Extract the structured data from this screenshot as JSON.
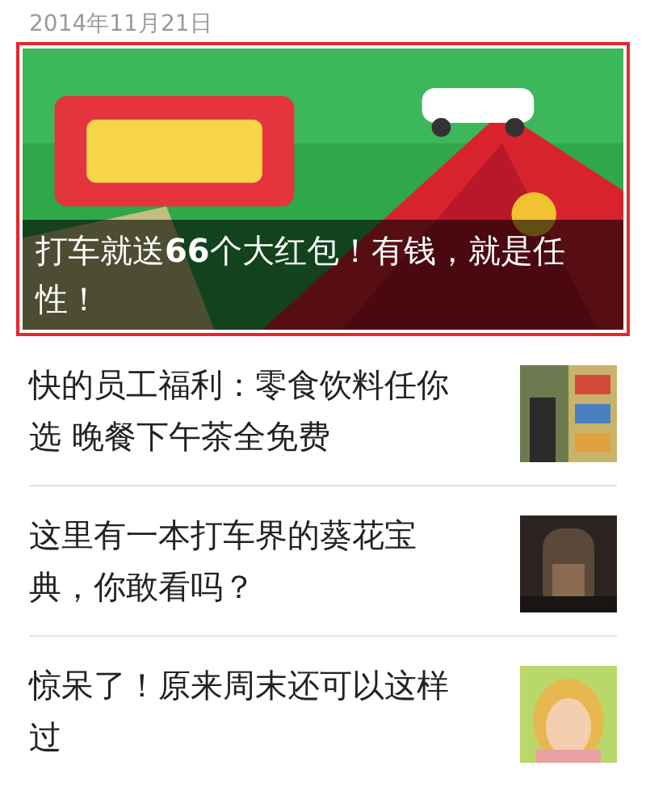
{
  "date": "2014年11月21日",
  "featured": {
    "caption": "打车就送**66**个大红包！有钱，就是任性！",
    "selected": true
  },
  "articles": [
    {
      "title": "快的员工福利：零食饮料任你选 晚餐下午茶全免费"
    },
    {
      "title": "这里有一本打车界的葵花宝典，你敢看吗？"
    },
    {
      "title": "惊呆了！原来周末还可以这样过"
    }
  ]
}
